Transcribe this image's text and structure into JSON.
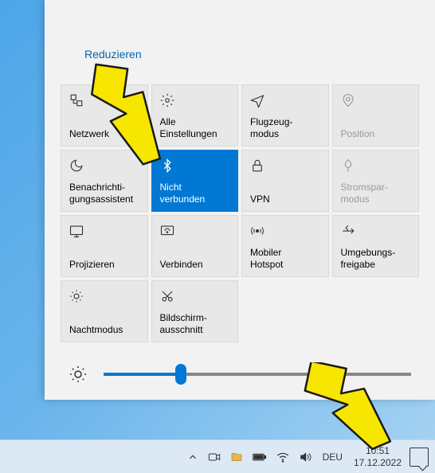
{
  "reduce": "Reduzieren",
  "tiles": [
    {
      "label": "Netzwerk"
    },
    {
      "label": "Alle\nEinstellungen"
    },
    {
      "label": "Flugzeug-\nmodus"
    },
    {
      "label": "Position"
    },
    {
      "label": "Benachrichti-\ngungsassistent"
    },
    {
      "label": "Nicht\nverbunden"
    },
    {
      "label": "VPN"
    },
    {
      "label": "Stromspar-\nmodus"
    },
    {
      "label": "Projizieren"
    },
    {
      "label": "Verbinden"
    },
    {
      "label": "Mobiler\nHotspot"
    },
    {
      "label": "Umgebungs-\nfreigabe"
    },
    {
      "label": "Nachtmodus"
    },
    {
      "label": "Bildschirm-\nausschnitt"
    }
  ],
  "lang": "DEU",
  "time": "10:51",
  "date": "17.12.2022",
  "brightness": 25
}
